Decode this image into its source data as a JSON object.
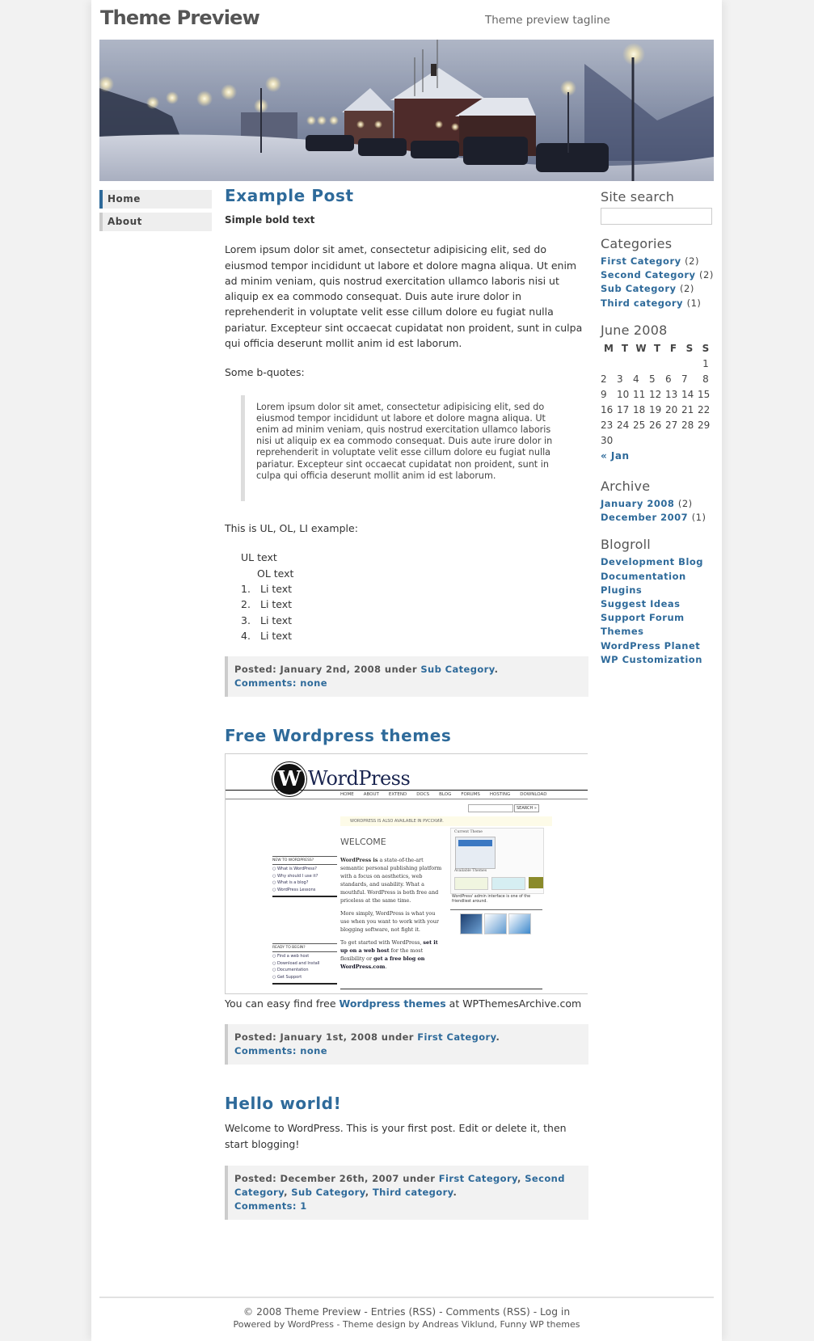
{
  "site": {
    "title": "Theme Preview",
    "tagline": "Theme preview tagline",
    "accent_color": "#2e6a9a"
  },
  "nav": {
    "items": [
      {
        "label": "Home",
        "active": true
      },
      {
        "label": "About",
        "active": false
      }
    ]
  },
  "posts": [
    {
      "title": "Example Post",
      "bold_text": "Simple bold text",
      "paragraph": "Lorem ipsum dolor sit amet, consectetur adipisicing elit, sed do eiusmod tempor incididunt ut labore et dolore magna aliqua. Ut enim ad minim veniam, quis nostrud exercitation ullamco laboris nisi ut aliquip ex ea commodo consequat. Duis aute irure dolor in reprehenderit in voluptate velit esse cillum dolore eu fugiat nulla pariatur. Excepteur sint occaecat cupidatat non proident, sunt in culpa qui officia deserunt mollit anim id est laborum.",
      "bquote_intro": "Some b-quotes:",
      "blockquote": "Lorem ipsum dolor sit amet, consectetur adipisicing elit, sed do eiusmod tempor incididunt ut labore et dolore magna aliqua. Ut enim ad minim veniam, quis nostrud exercitation ullamco laboris nisi ut aliquip ex ea commodo consequat. Duis aute irure dolor in reprehenderit in voluptate velit esse cillum dolore eu fugiat nulla pariatur. Excepteur sint occaecat cupidatat non proident, sunt in culpa qui officia deserunt mollit anim id est laborum.",
      "list_intro": "This is UL, OL, LI example:",
      "ul_text": "UL text",
      "ol_text": "OL text",
      "li_items": [
        {
          "num": "1.",
          "text": "Li text"
        },
        {
          "num": "2.",
          "text": "Li text"
        },
        {
          "num": "3.",
          "text": "Li text"
        },
        {
          "num": "4.",
          "text": "Li text"
        }
      ],
      "meta": {
        "posted": "Posted: January 2nd, 2008 under",
        "categories": [
          "Sub Category"
        ],
        "comments": "Comments: none"
      }
    },
    {
      "title": "Free Wordpress themes",
      "screenshot": {
        "logo_text": "WordPress",
        "nav": [
          "HOME",
          "ABOUT",
          "EXTEND",
          "DOCS",
          "BLOG",
          "FORUMS",
          "HOSTING",
          "DOWNLOAD"
        ],
        "search_button": "SEARCH »",
        "notice": "WORDPRESS IS ALSO AVAILABLE IN РУССКИЙ.",
        "welcome": "WELCOME",
        "new_heading": "NEW TO WORDPRESS?",
        "new_links": [
          "What is WordPress?",
          "Why should I use it?",
          "What is a blog?",
          "WordPress Lessons"
        ],
        "ready_heading": "READY TO BEGIN?",
        "ready_links": [
          "Find a web host",
          "Download and Install",
          "Documentation",
          "Get Support"
        ],
        "para1_bold": "WordPress is",
        "para1": " a state-of-the-art semantic personal publishing platform with a focus on aesthetics, web standards, and usability. What a mouthful. WordPress is both free and priceless at the same time.",
        "para2": "More simply, WordPress is what you use when you want to work with your blogging software, not fight it.",
        "para3_a": "To get started with WordPress, ",
        "para3_link1": "set it up on a web host",
        "para3_b": " for the most flexibility or ",
        "para3_link2": "get a free blog on WordPress.com",
        "para3_c": ".",
        "current_theme": "Current Theme",
        "available_themes": "Available Themes",
        "caption": "WordPress' admin interface is one of the friendliest around."
      },
      "text_before": "You can easy find free ",
      "text_link": "Wordpress themes",
      "text_after": " at WPThemesArchive.com",
      "meta": {
        "posted": "Posted: January 1st, 2008 under",
        "categories": [
          "First Category"
        ],
        "comments": "Comments: none"
      }
    },
    {
      "title": "Hello world!",
      "paragraph": "Welcome to WordPress. This is your first post. Edit or delete it, then start blogging!",
      "meta": {
        "posted": "Posted: December 26th, 2007 under",
        "categories": [
          "First Category",
          "Second Category",
          "Sub Category",
          "Third category"
        ],
        "comments": "Comments: 1"
      }
    }
  ],
  "sidebar": {
    "search": {
      "heading": "Site search",
      "value": "",
      "placeholder": ""
    },
    "categories": {
      "heading": "Categories",
      "items": [
        {
          "label": "First Category",
          "count": "(2)"
        },
        {
          "label": "Second Category",
          "count": "(2)"
        },
        {
          "label": "Sub Category",
          "count": "(2)"
        },
        {
          "label": "Third category",
          "count": "(1)"
        }
      ]
    },
    "calendar": {
      "heading": "June 2008",
      "weekdays": [
        "M",
        "T",
        "W",
        "T",
        "F",
        "S",
        "S"
      ],
      "weeks": [
        [
          "",
          "",
          "",
          "",
          "",
          "",
          "1"
        ],
        [
          "2",
          "3",
          "4",
          "5",
          "6",
          "7",
          "8"
        ],
        [
          "9",
          "10",
          "11",
          "12",
          "13",
          "14",
          "15"
        ],
        [
          "16",
          "17",
          "18",
          "19",
          "20",
          "21",
          "22"
        ],
        [
          "23",
          "24",
          "25",
          "26",
          "27",
          "28",
          "29"
        ],
        [
          "30",
          "",
          "",
          "",
          "",
          "",
          ""
        ]
      ],
      "prev_link": "« Jan"
    },
    "archive": {
      "heading": "Archive",
      "items": [
        {
          "label": "January 2008",
          "count": "(2)"
        },
        {
          "label": "December 2007",
          "count": "(1)"
        }
      ]
    },
    "blogroll": {
      "heading": "Blogroll",
      "items": [
        "Development Blog",
        "Documentation",
        "Plugins",
        "Suggest Ideas",
        "Support Forum",
        "Themes",
        "WordPress Planet",
        "WP Customization"
      ]
    }
  },
  "footer": {
    "line1": "© 2008 Theme Preview - Entries (RSS) - Comments (RSS) - Log in",
    "line2": "Powered by WordPress - Theme design by Andreas Viklund, Funny WP themes"
  }
}
